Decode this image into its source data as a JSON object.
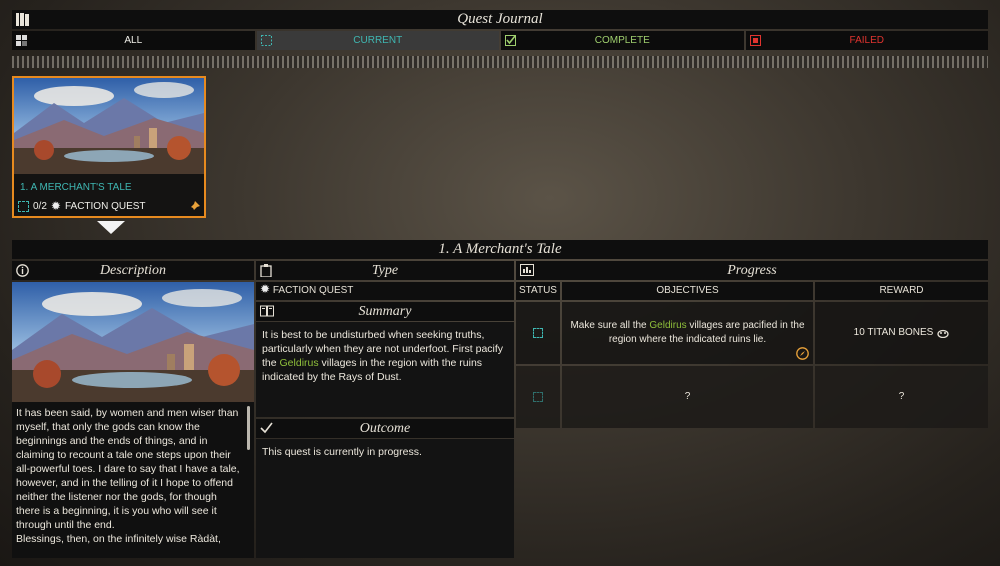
{
  "header": {
    "title": "Quest Journal"
  },
  "tabs": [
    {
      "label": "ALL",
      "icon": "grid-icon"
    },
    {
      "label": "CURRENT",
      "icon": "dashed-square-icon"
    },
    {
      "label": "COMPLETE",
      "icon": "checkbox-icon"
    },
    {
      "label": "FAILED",
      "icon": "x-box-icon"
    }
  ],
  "quest_card": {
    "title": "1. A MERCHANT'S TALE",
    "progress": "0/2",
    "type": "FACTION QUEST"
  },
  "quest": {
    "title": "1. A Merchant's Tale",
    "description_header": "Description",
    "type_header": "Type",
    "progress_header": "Progress",
    "type_value": "FACTION QUEST",
    "summary_header": "Summary",
    "summary_pre": "It is best to be undisturbed when seeking truths, particularly when they are not underfoot. First pacify the ",
    "summary_highlight": "Geldirus",
    "summary_post": " villages in the region with the ruins indicated by the Rays of Dust.",
    "outcome_header": "Outcome",
    "outcome_text": "This quest is currently in progress.",
    "description_text": "It has been said, by women and men wiser than myself, that only the gods can know the beginnings and the ends of things, and in claiming to recount a tale one steps upon their all-powerful toes. I dare to say that I have a tale, however, and in the telling of it I hope to offend neither the listener nor the gods, for though there is a beginning, it is you who will see it through until the end.",
    "description_text2": "Blessings, then, on the infinitely wise Ràdàt,"
  },
  "table": {
    "headers": {
      "status": "STATUS",
      "objectives": "OBJECTIVES",
      "reward": "REWARD"
    },
    "rows": [
      {
        "objective_pre": "Make sure all the ",
        "objective_highlight": "Geldirus",
        "objective_post": " villages are pacified in the region where the indicated ruins lie.",
        "reward": "10 TITAN BONES"
      },
      {
        "objective": "?",
        "reward": "?"
      }
    ]
  },
  "colors": {
    "accent_orange": "#e78a1f",
    "current_teal": "#3fb7b2",
    "complete_green": "#9fcf6e",
    "failed_red": "#e0342f",
    "highlight_green": "#8fbf3b"
  }
}
